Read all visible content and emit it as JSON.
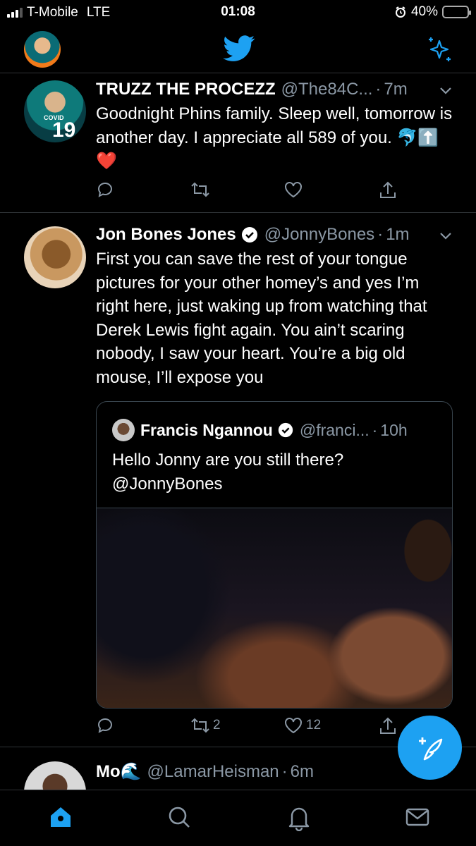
{
  "status_bar": {
    "carrier": "T-Mobile",
    "network": "LTE",
    "time": "01:08",
    "battery_percent": "40%",
    "battery_level": 0.4,
    "battery_color": "#ffd60a"
  },
  "header": {
    "logo_icon": "twitter-bird-icon",
    "right_icon": "sparkle-icon"
  },
  "tweets": [
    {
      "name": "TRUZZ THE PROCEZZ",
      "handle": "@The84C...",
      "time": "7m",
      "text": "Goodnight Phins family. Sleep well, tomorrow is another day. I appreciate all 589 of you. 🐬⬆️❤️",
      "replies": "",
      "retweets": "",
      "likes": ""
    },
    {
      "name": "Jon Bones Jones",
      "verified": true,
      "handle": "@JonnyBones",
      "time": "1m",
      "text": "First you can save the rest of your tongue pictures for your other homey’s and yes I’m right here, just waking up from watching that Derek Lewis fight again. You ain’t scaring nobody, I saw your heart. You’re a big old mouse, I’ll expose you",
      "quote": {
        "name": "Francis Ngannou",
        "verified": true,
        "handle": "@franci...",
        "time": "10h",
        "text": "Hello Jonny are you still there? @JonnyBones"
      },
      "replies": "",
      "retweets": "2",
      "likes": "12"
    },
    {
      "name": "Mo🌊",
      "handle": "@LamarHeisman",
      "time": "6m"
    }
  ],
  "tabbar": {
    "items": [
      "home-icon",
      "search-icon",
      "notifications-icon",
      "messages-icon"
    ]
  },
  "colors": {
    "accent": "#1da1f2",
    "muted": "#8b98a5",
    "divider": "#2f3336"
  }
}
